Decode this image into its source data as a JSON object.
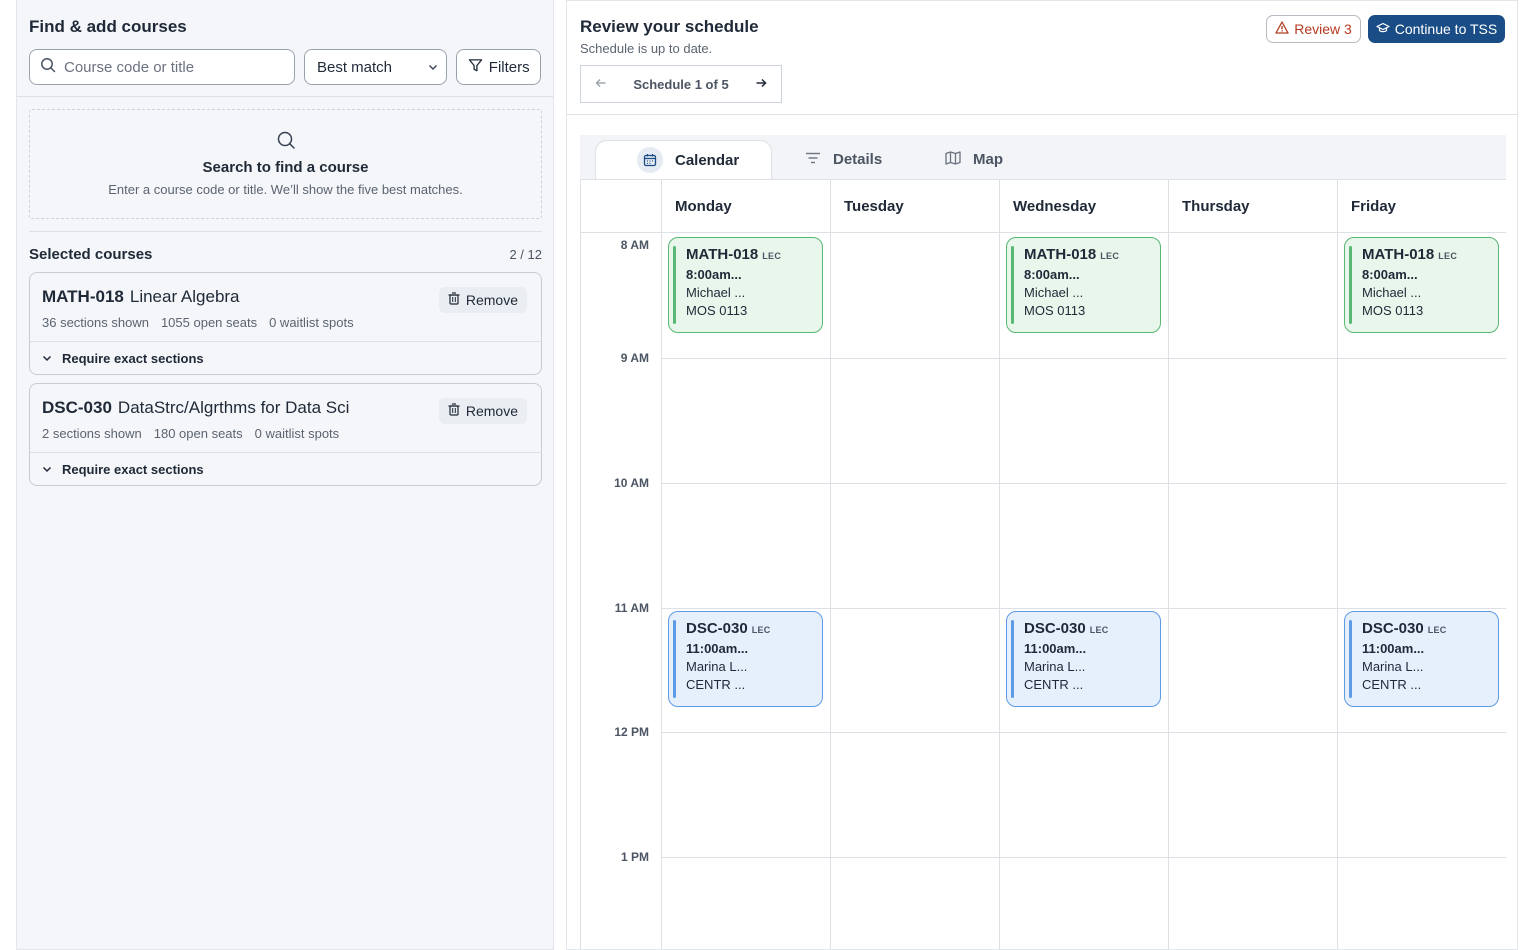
{
  "left": {
    "title": "Find & add courses",
    "search_placeholder": "Course code or title",
    "sort_value": "Best match",
    "filters_label": "Filters",
    "empty_title": "Search to find a course",
    "empty_sub": "Enter a course code or title. We’ll show the five best matches.",
    "selected_title": "Selected courses",
    "selected_count": "2 / 12",
    "courses": [
      {
        "code": "MATH-018",
        "name": "Linear Algebra",
        "sections": "36 sections shown",
        "seats": "1055 open seats",
        "waitlist": "0 waitlist spots",
        "remove_label": "Remove",
        "require_label": "Require exact sections"
      },
      {
        "code": "DSC-030",
        "name": "DataStrc/Algrthms for Data Sci",
        "sections": "2 sections shown",
        "seats": "180 open seats",
        "waitlist": "0 waitlist spots",
        "remove_label": "Remove",
        "require_label": "Require exact sections"
      }
    ]
  },
  "right": {
    "title": "Review your schedule",
    "subtitle": "Schedule is up to date.",
    "pager_label": "Schedule 1 of 5",
    "review_label": "Review 3",
    "tss_label": "Continue to TSS",
    "tabs": [
      "Calendar",
      "Details",
      "Map"
    ],
    "days": [
      "Monday",
      "Tuesday",
      "Wednesday",
      "Thursday",
      "Friday"
    ],
    "hours": [
      "8 AM",
      "9 AM",
      "10 AM",
      "11 AM",
      "12 PM",
      "1 PM"
    ],
    "events": {
      "math": {
        "code": "MATH-018",
        "type": "LEC",
        "time": "8:00am...",
        "instructor": "Michael ...",
        "room": "MOS 0113"
      },
      "dsc": {
        "code": "DSC-030",
        "type": "LEC",
        "time": "11:00am...",
        "instructor": "Marina L...",
        "room": "CENTR ..."
      }
    }
  },
  "colors": {
    "primary": "#1a4d86",
    "warning": "#b43a22",
    "math_event": "#58b874",
    "dsc_event": "#5e9be6"
  }
}
